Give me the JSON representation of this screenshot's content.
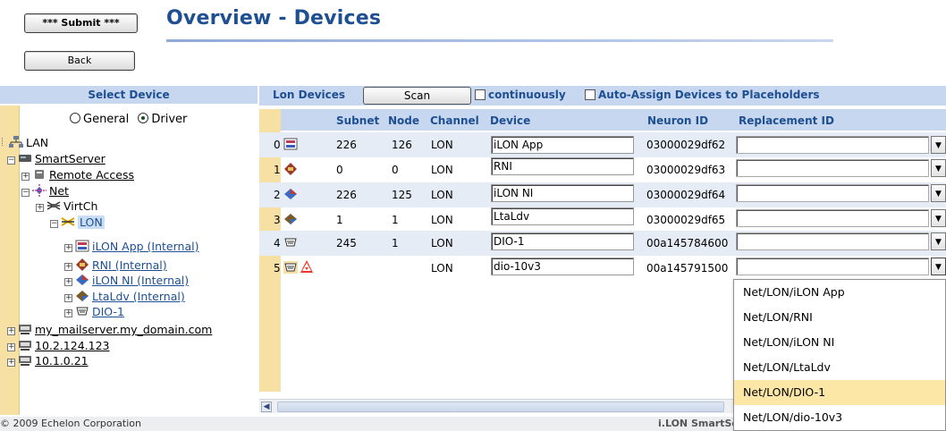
{
  "header": {
    "submit_label": "*** Submit ***",
    "back_label": "Back",
    "title": "Overview - Devices"
  },
  "left_panel": {
    "header": "Select Device",
    "radio_general": "General",
    "radio_driver": "Driver",
    "radio_selected": "Driver",
    "tree": [
      {
        "label": "LAN",
        "icon": "network-icon"
      },
      {
        "label": "SmartServer",
        "icon": "server-icon"
      },
      {
        "label": "Remote Access",
        "icon": "phone-icon"
      },
      {
        "label": "Net",
        "icon": "net-icon"
      },
      {
        "label": "VirtCh",
        "icon": "virtual-channel-icon"
      },
      {
        "label": "LON",
        "icon": "lon-channel-icon"
      },
      {
        "label": "iLON App (Internal)",
        "icon": "app-device-icon"
      },
      {
        "label": "RNI (Internal)",
        "icon": "rni-device-icon"
      },
      {
        "label": "iLON NI (Internal)",
        "icon": "ni-device-icon"
      },
      {
        "label": "LtaLdv (Internal)",
        "icon": "ldv-device-icon"
      },
      {
        "label": "DIO-1",
        "icon": "dio-device-icon"
      },
      {
        "label": "my_mailserver.my_domain.com",
        "icon": "computer-icon"
      },
      {
        "label": "10.2.124.123",
        "icon": "computer-icon"
      },
      {
        "label": "10.1.0.21",
        "icon": "computer-icon"
      }
    ]
  },
  "lon_devices": {
    "title": "Lon Devices",
    "scan_label": "Scan",
    "continuously_label": "continuously",
    "auto_assign_label": "Auto-Assign Devices to Placeholders",
    "columns": {
      "subnet": "Subnet",
      "node": "Node",
      "channel": "Channel",
      "device": "Device",
      "neuron_id": "Neuron ID",
      "replacement_id": "Replacement ID"
    },
    "rows": [
      {
        "index": "0",
        "subnet": "226",
        "node": "126",
        "channel": "LON",
        "device": "iLON App",
        "neuron_id": "03000029df62"
      },
      {
        "index": "1",
        "subnet": "0",
        "node": "0",
        "channel": "LON",
        "device": "RNI",
        "neuron_id": "03000029df63"
      },
      {
        "index": "2",
        "subnet": "226",
        "node": "125",
        "channel": "LON",
        "device": "iLON NI",
        "neuron_id": "03000029df64"
      },
      {
        "index": "3",
        "subnet": "1",
        "node": "1",
        "channel": "LON",
        "device": "LtaLdv",
        "neuron_id": "03000029df65"
      },
      {
        "index": "4",
        "subnet": "245",
        "node": "1",
        "channel": "LON",
        "device": "DIO-1",
        "neuron_id": "00a145784600"
      },
      {
        "index": "5",
        "subnet": "",
        "node": "",
        "channel": "LON",
        "device": "dio-10v3",
        "neuron_id": "00a145791500"
      }
    ]
  },
  "dropdown": {
    "options": [
      "Net/LON/iLON App",
      "Net/LON/RNI",
      "Net/LON/iLON NI",
      "Net/LON/LtaLdv",
      "Net/LON/DIO-1",
      "Net/LON/dio-10v3"
    ],
    "highlighted": "Net/LON/DIO-1"
  },
  "footer": {
    "copyright": "2009 Echelon Corporation",
    "product": "i.LON SmartServ"
  },
  "colors": {
    "accent": "#1f4f93",
    "header_band": "#c6d7ef",
    "stripe": "#f6e0a4",
    "highlight": "#fde7a6"
  }
}
